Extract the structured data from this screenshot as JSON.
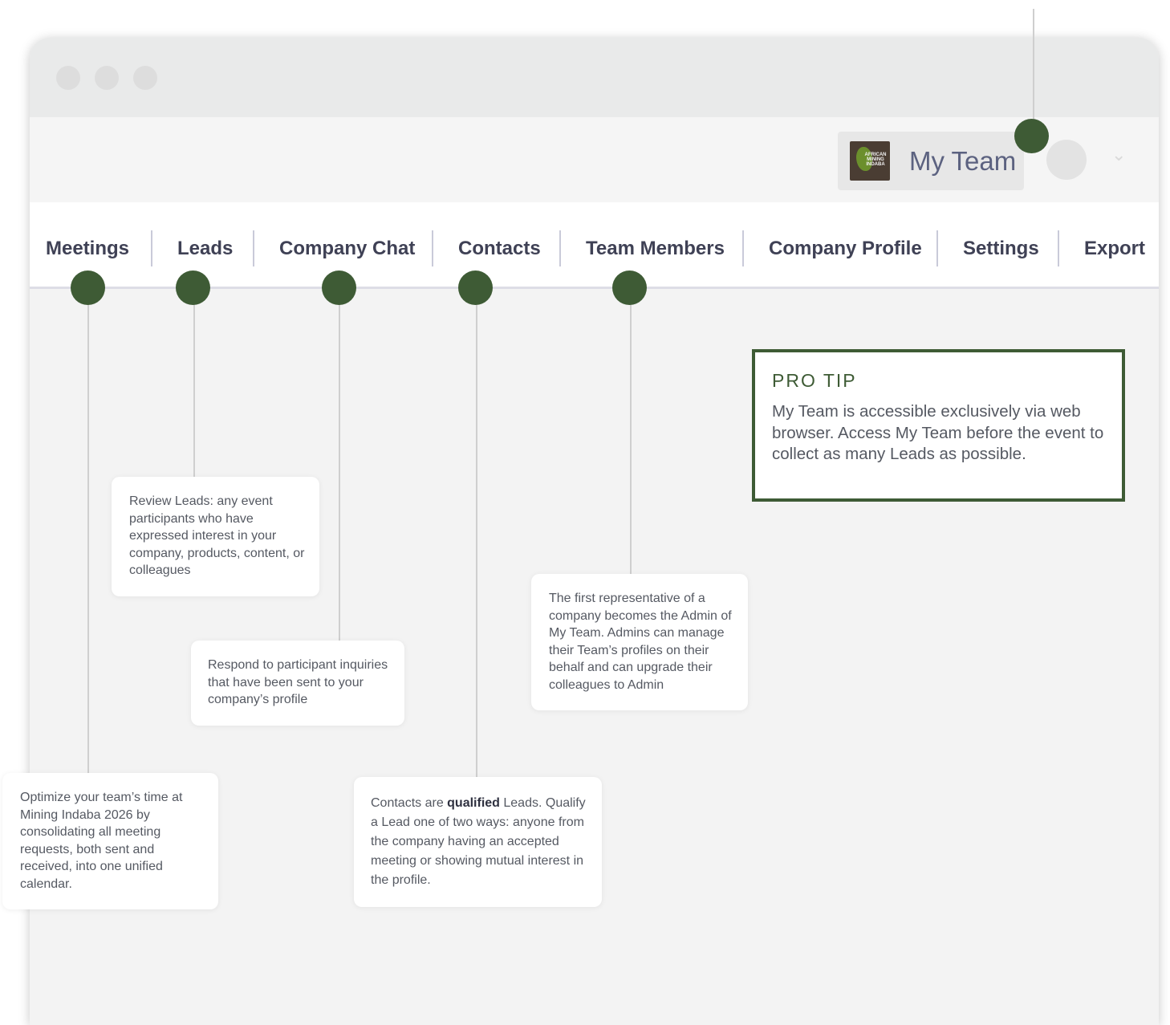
{
  "header": {
    "team_name": "My Team",
    "logo_text": "AFRICAN MINING INDABA"
  },
  "nav": {
    "items": [
      "Meetings",
      "Leads",
      "Company Chat",
      "Contacts",
      "Team Members",
      "Company Profile",
      "Settings",
      "Export"
    ]
  },
  "callouts": {
    "meetings": "Optimize your team’s time at Mining Indaba 2026 by consolidating all meeting requests, both sent and received, into one unified calendar.",
    "leads": "Review Leads: any event participants who have expressed interest in your company, products, content, or colleagues",
    "company_chat": "Respond to participant inquiries that have been sent to your company’s profile",
    "contacts": {
      "prefix": "Contacts are ",
      "bold": "qualified",
      "suffix": " Leads. Qualify a Lead one of two ways: anyone from the company having an accepted meeting or showing mutual interest in the profile."
    },
    "team_members": "The first representative of a company becomes the Admin of My Team. Admins can manage their Team’s profiles on their behalf and can upgrade their colleagues to Admin"
  },
  "protip": {
    "title": "PRO TIP",
    "body": "My Team is accessible exclusively via web browser. Access My Team before the event to collect as many Leads as possible."
  },
  "colors": {
    "accent_green": "#3e5b35",
    "nav_text": "#3f4155",
    "team_name": "#5c6280"
  }
}
